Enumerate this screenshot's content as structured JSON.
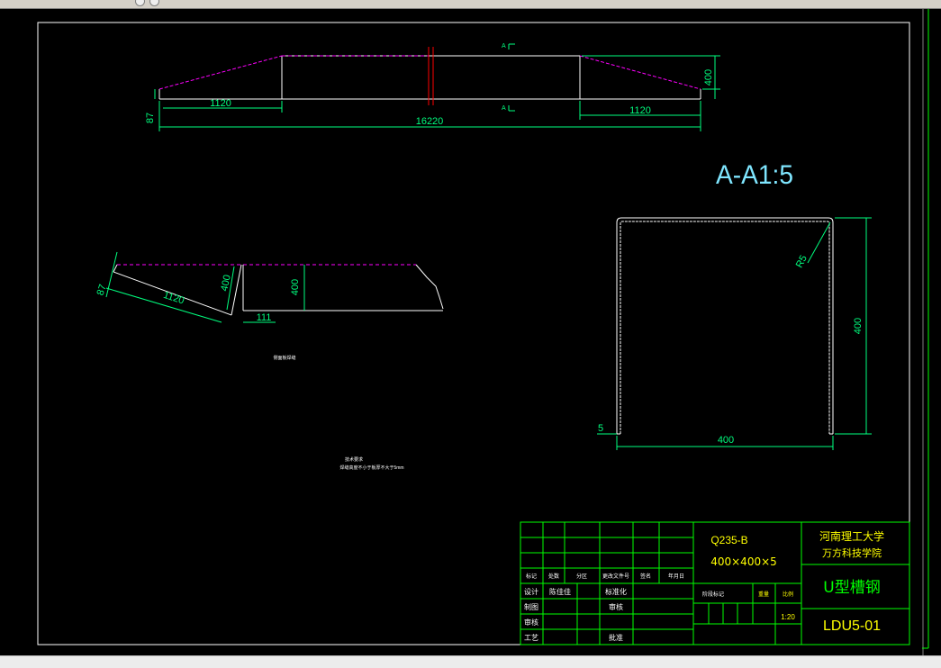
{
  "drawing": {
    "elevation": {
      "dim_total": "16220",
      "dim_left_slope": "1120",
      "dim_right_slope": "1120",
      "dim_height": "400",
      "dim_end_height": "87",
      "section_mark_top": "A",
      "section_mark_bottom": "A"
    },
    "detail": {
      "dim_slope": "1120",
      "dim_height_slope": "400",
      "dim_height": "400",
      "dim_end": "87",
      "dim_gap": "111",
      "caption": "侧面板焊缝"
    },
    "section": {
      "title": "A-A1:5",
      "dim_radius": "R5",
      "dim_height": "400",
      "dim_width": "400",
      "dim_thickness": "5"
    },
    "notes": {
      "heading": "技术要求",
      "line1": "焊缝高度不小于板厚不大于5mm"
    },
    "title_block": {
      "material": "Q235-B",
      "spec": "400×400×5",
      "school_line1": "河南理工大学",
      "school_line2": "万方科技学院",
      "part_name": "U型槽钢",
      "drawing_no": "LDU5-01",
      "scale": "1:20",
      "scale_header": "比例",
      "weight_header": "重量",
      "stage_label": "阶段标记",
      "header_row": [
        "标记",
        "处数",
        "分区",
        "更改文件号",
        "签名",
        "年月日"
      ],
      "role_design": "设计",
      "designer": "陈佳佳",
      "role_standard": "标准化",
      "role_draw": "制图",
      "role_review": "审核",
      "role_audit": "审核",
      "role_process": "工艺",
      "role_approve": "批准"
    }
  },
  "colors": {
    "background": "#000000",
    "line_white": "#ffffff",
    "dim_green": "#00ff7f",
    "section_cyan": "#7fe6ff",
    "dash_magenta": "#ff00ff",
    "cut_red": "#ff0000",
    "title_green": "#00ff00",
    "title_yellow": "#ffff00"
  }
}
